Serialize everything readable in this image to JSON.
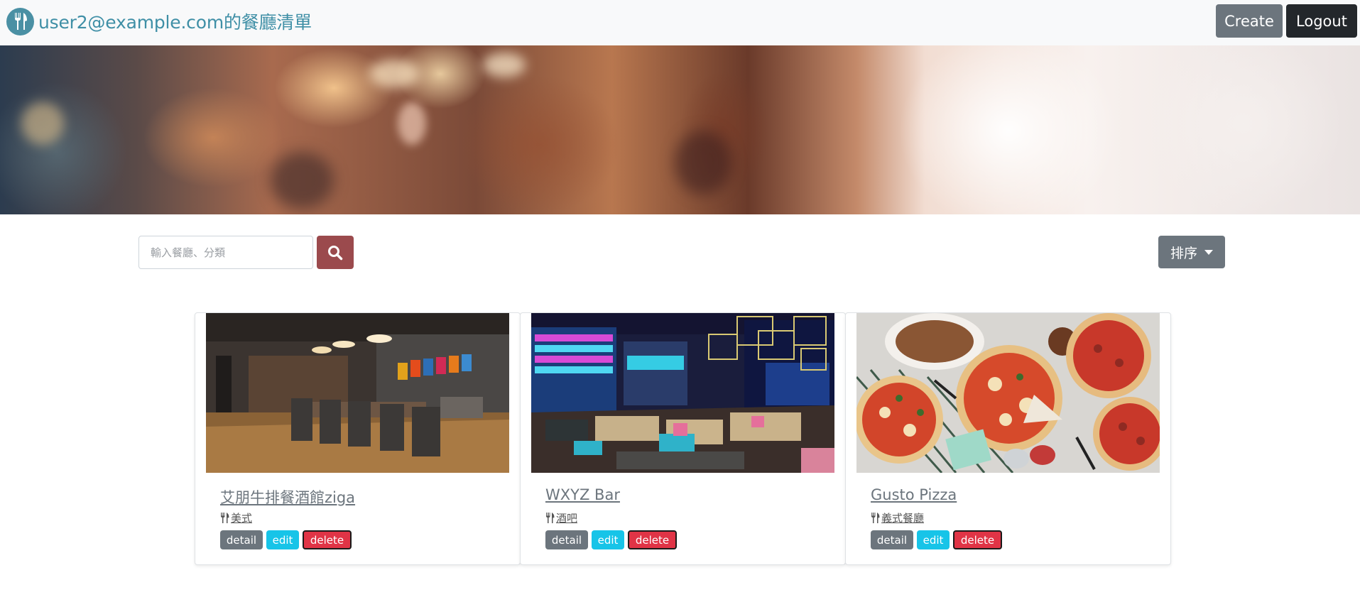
{
  "header": {
    "title": "user2@example.com的餐廳清單",
    "logo_icon": "utensils-icon",
    "create_label": "Create",
    "logout_label": "Logout"
  },
  "search": {
    "placeholder": "輸入餐廳、分類",
    "value": "",
    "button_icon": "search-icon",
    "button_color": "#9b4a4d"
  },
  "sort": {
    "label": "排序"
  },
  "restaurants": [
    {
      "name": "艾朋牛排餐酒館ziga",
      "category": "美式",
      "detail_label": "detail",
      "edit_label": "edit",
      "delete_label": "delete"
    },
    {
      "name": "WXYZ Bar",
      "category": "酒吧",
      "detail_label": "detail",
      "edit_label": "edit",
      "delete_label": "delete"
    },
    {
      "name": "Gusto Pizza",
      "category": "義式餐廳",
      "detail_label": "detail",
      "edit_label": "edit",
      "delete_label": "delete"
    }
  ],
  "colors": {
    "brand": "#3f8fa6",
    "secondary": "#6c757d",
    "dark": "#23272b",
    "info": "#17c4e8",
    "danger": "#e03446"
  }
}
